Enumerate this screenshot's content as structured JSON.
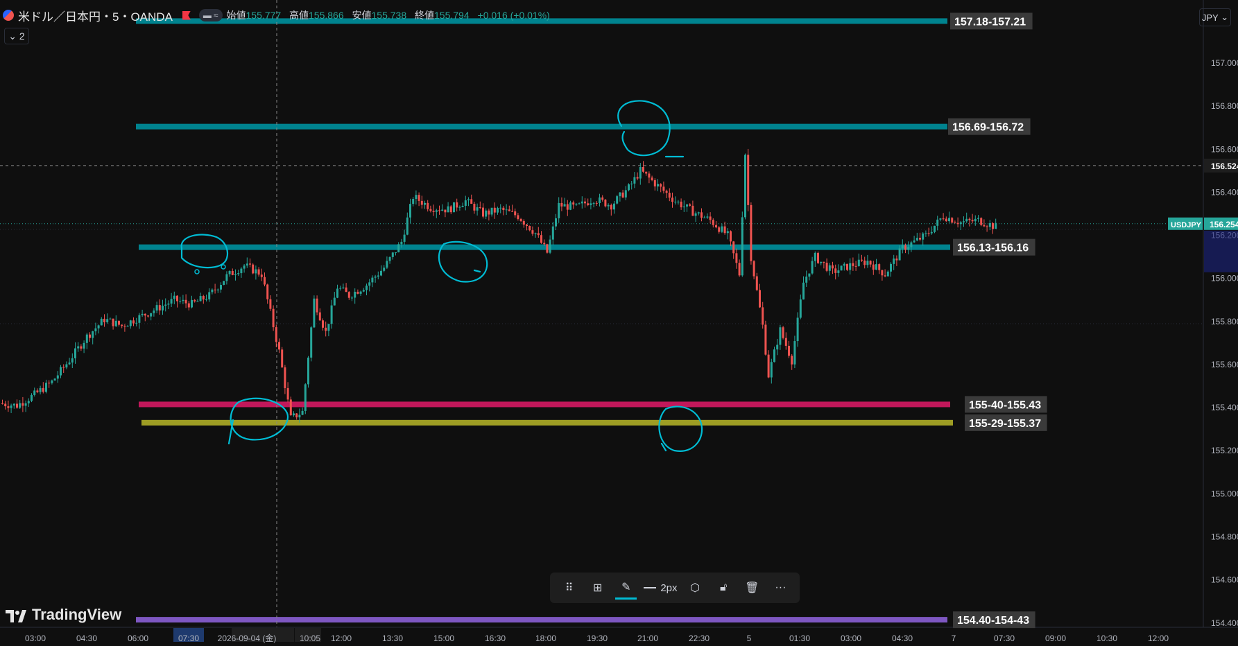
{
  "header": {
    "symbol": "米ドル／日本円・5・OANDA",
    "open_label": "始値",
    "open": "155.777",
    "high_label": "高値",
    "high": "155.866",
    "low_label": "安値",
    "low": "155.738",
    "close_label": "終値",
    "close": "155.794",
    "change": "+0.016 (+0.01%)"
  },
  "layers_button": "2",
  "currency": "JPY",
  "chart_data": {
    "type": "candlestick",
    "ylim": [
      154.38,
      157.28
    ],
    "y_ticks": [
      "157.000",
      "156.800",
      "156.600",
      "156.400",
      "156.200",
      "156.000",
      "155.800",
      "155.600",
      "155.400",
      "155.200",
      "155.000",
      "154.800",
      "154.600",
      "154.400"
    ],
    "x_ticks": [
      "03:00",
      "04:30",
      "06:00",
      "07:30",
      "2026-09-04 (金)",
      "10:05",
      "12:00",
      "13:30",
      "15:00",
      "16:30",
      "18:00",
      "19:30",
      "21:00",
      "22:30",
      "5",
      "01:30",
      "03:00",
      "04:30",
      "7",
      "07:30",
      "09:00",
      "10:30",
      "12:00"
    ],
    "current_price": {
      "label": "USDJPY",
      "value": "156.254"
    },
    "crosshair_price": "156.524",
    "colors": {
      "up": "#26a69a",
      "down": "#ef5350"
    },
    "zones": [
      {
        "label": "157.18-157.21",
        "value": 157.195,
        "color": "#00838f"
      },
      {
        "label": "156.69-156.72",
        "value": 156.705,
        "color": "#00838f"
      },
      {
        "label": "156.13-156.16",
        "value": 156.145,
        "color": "#00838f"
      },
      {
        "label": "155-40-155.43",
        "value": 155.415,
        "color": "#c2185b"
      },
      {
        "label": "155-29-155.37",
        "value": 155.33,
        "color": "#9e9d24"
      },
      {
        "label": "154.40-154-43",
        "value": 154.415,
        "color": "#7e57c2"
      }
    ],
    "price_path": [
      [
        0,
        155.42
      ],
      [
        6,
        155.41
      ],
      [
        12,
        155.46
      ],
      [
        18,
        155.52
      ],
      [
        24,
        155.62
      ],
      [
        30,
        155.73
      ],
      [
        36,
        155.81
      ],
      [
        42,
        155.78
      ],
      [
        48,
        155.82
      ],
      [
        54,
        155.86
      ],
      [
        60,
        155.9
      ],
      [
        66,
        155.88
      ],
      [
        72,
        155.92
      ],
      [
        78,
        156.01
      ],
      [
        84,
        156.06
      ],
      [
        90,
        156.02
      ],
      [
        96,
        155.66
      ],
      [
        100,
        155.35
      ],
      [
        104,
        155.38
      ],
      [
        108,
        155.9
      ],
      [
        112,
        155.75
      ],
      [
        116,
        155.96
      ],
      [
        120,
        155.92
      ],
      [
        126,
        155.97
      ],
      [
        132,
        156.05
      ],
      [
        138,
        156.17
      ],
      [
        142,
        156.38
      ],
      [
        148,
        156.33
      ],
      [
        154,
        156.32
      ],
      [
        160,
        156.36
      ],
      [
        166,
        156.3
      ],
      [
        172,
        156.32
      ],
      [
        178,
        156.29
      ],
      [
        184,
        156.21
      ],
      [
        188,
        156.12
      ],
      [
        192,
        156.34
      ],
      [
        198,
        156.33
      ],
      [
        204,
        156.37
      ],
      [
        210,
        156.34
      ],
      [
        216,
        156.42
      ],
      [
        220,
        156.5
      ],
      [
        226,
        156.43
      ],
      [
        232,
        156.36
      ],
      [
        238,
        156.31
      ],
      [
        244,
        156.27
      ],
      [
        250,
        156.2
      ],
      [
        254,
        156.02
      ],
      [
        256,
        156.58
      ],
      [
        258,
        156.1
      ],
      [
        262,
        155.78
      ],
      [
        264,
        155.55
      ],
      [
        268,
        155.76
      ],
      [
        272,
        155.62
      ],
      [
        276,
        155.98
      ],
      [
        280,
        156.1
      ],
      [
        286,
        156.03
      ],
      [
        292,
        156.06
      ],
      [
        298,
        156.08
      ],
      [
        304,
        156.02
      ],
      [
        310,
        156.14
      ],
      [
        318,
        156.2
      ],
      [
        324,
        156.29
      ],
      [
        330,
        156.26
      ],
      [
        336,
        156.27
      ],
      [
        342,
        156.24
      ]
    ],
    "annotations": "hand-drawn circles at swing highs/lows"
  },
  "toolbar": {
    "stroke_width": "2px"
  },
  "brand": "TradingView"
}
